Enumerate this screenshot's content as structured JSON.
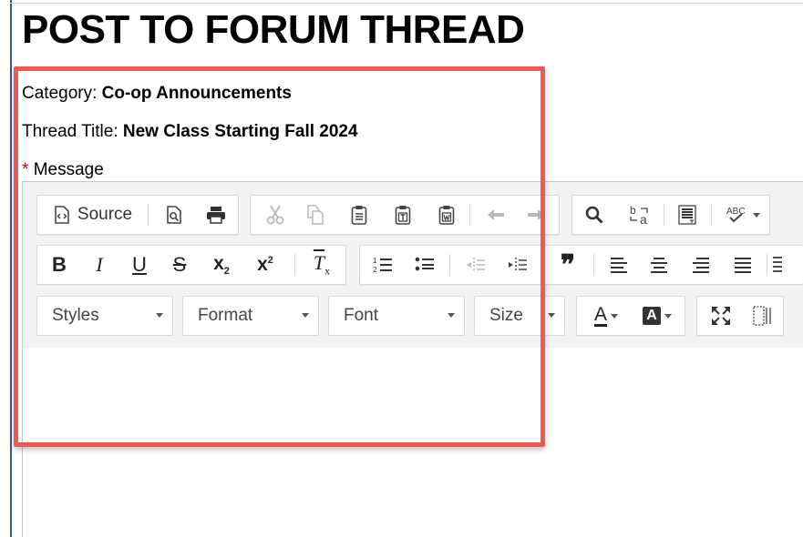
{
  "page": {
    "title": "POST TO FORUM THREAD"
  },
  "form": {
    "category_label": "Category:",
    "category_value": "Co-op Announcements",
    "thread_title_label": "Thread Title:",
    "thread_title_value": "New Class Starting Fall 2024",
    "required_marker": "*",
    "message_label": "Message"
  },
  "editor": {
    "toolbar_row1": {
      "source_label": "Source"
    },
    "toolbar_row2": {
      "bold": "B",
      "italic": "I",
      "underline": "U",
      "strike": "S",
      "subscript_base": "x",
      "subscript_mark": "2",
      "superscript_base": "x",
      "superscript_mark": "2",
      "remove_format": "T",
      "remove_format_mark": "x",
      "blockquote": "❞"
    },
    "toolbar_row3": {
      "styles": "Styles",
      "format": "Format",
      "font": "Font",
      "size": "Size",
      "text_color": "A",
      "bg_color": "A"
    },
    "content": ""
  },
  "colors": {
    "highlight": "#ef5b50",
    "required": "#d0021b",
    "rule": "#2f5597"
  }
}
